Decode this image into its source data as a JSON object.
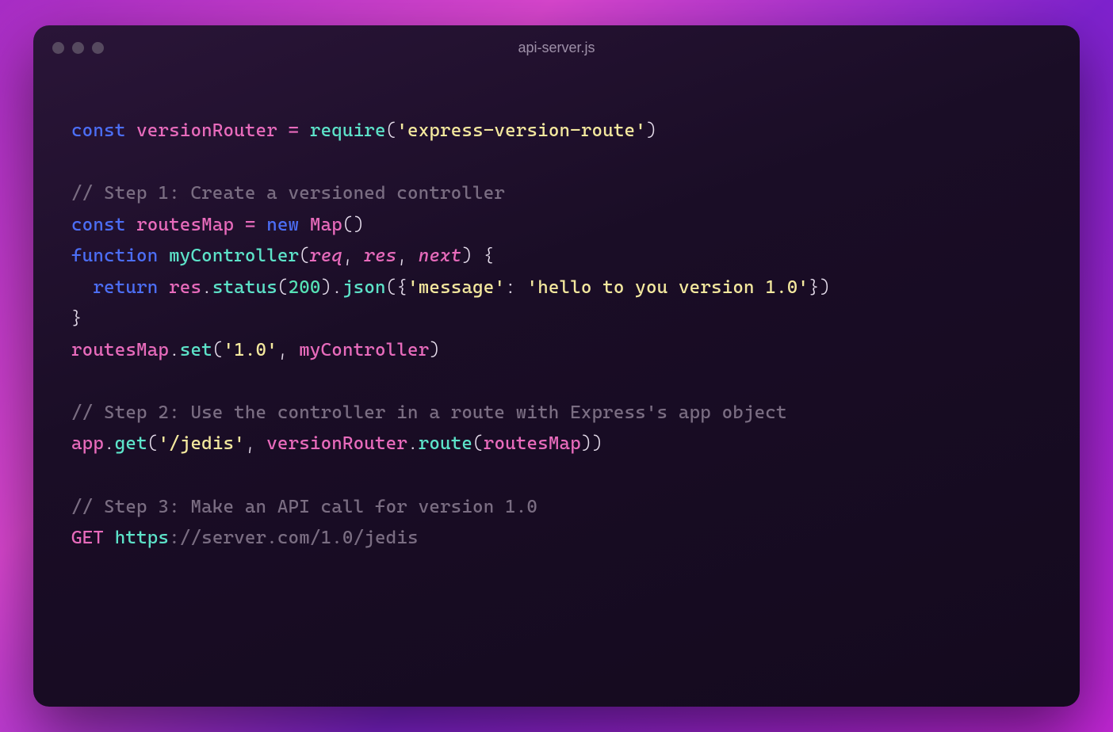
{
  "window": {
    "title": "api-server.js"
  },
  "code": {
    "line1": {
      "const": "const",
      "versionRouter": "versionRouter",
      "eq": " = ",
      "require": "require",
      "lparen": "(",
      "str": "'express-version-route'",
      "rparen": ")"
    },
    "line3": {
      "comment": "// Step 1: Create a versioned controller"
    },
    "line4": {
      "const": "const",
      "routesMap": "routesMap",
      "eq": " = ",
      "new": "new",
      "Map": "Map",
      "parens": "()"
    },
    "line5": {
      "function": "function",
      "myController": "myController",
      "lparen": "(",
      "req": "req",
      "c1": ", ",
      "res": "res",
      "c2": ", ",
      "next": "next",
      "rparen": ")",
      "lbrace": " {"
    },
    "line6": {
      "indent": "  ",
      "return": "return",
      "res": "res",
      "dot1": ".",
      "status": "status",
      "lparen1": "(",
      "num": "200",
      "rparen1": ")",
      "dot2": ".",
      "json": "json",
      "lparen2": "({",
      "key": "'message'",
      "colon": ": ",
      "val": "'hello to you version 1.0'",
      "rparen2": "})"
    },
    "line7": {
      "rbrace": "}"
    },
    "line8": {
      "routesMap": "routesMap",
      "dot": ".",
      "set": "set",
      "lparen": "(",
      "v": "'1.0'",
      "comma": ", ",
      "myController": "myController",
      "rparen": ")"
    },
    "line10": {
      "comment": "// Step 2: Use the controller in a route with Express's app object"
    },
    "line11": {
      "app": "app",
      "dot1": ".",
      "get": "get",
      "lparen1": "(",
      "path": "'/jedis'",
      "comma": ", ",
      "versionRouter": "versionRouter",
      "dot2": ".",
      "route": "route",
      "lparen2": "(",
      "routesMap": "routesMap",
      "rparen2": ")",
      "rparen1": ")"
    },
    "line13": {
      "comment": "// Step 3: Make an API call for version 1.0"
    },
    "line14": {
      "get": "GET ",
      "https": "https",
      "rest": "://server.com/1.0/jedis"
    }
  }
}
